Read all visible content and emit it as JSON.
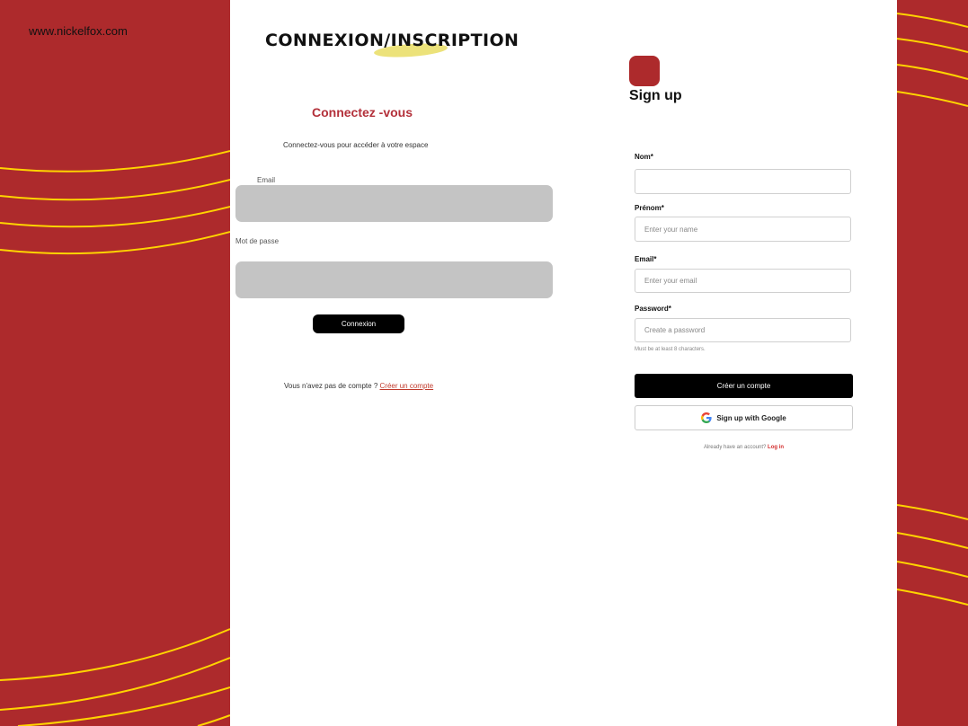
{
  "site": {
    "url": "www.nickelfox.com"
  },
  "colors": {
    "brand_red": "#ad2a2c",
    "accent_yellow": "#ffd400",
    "highlight_yellow": "#ece27a"
  },
  "header": {
    "title_left": "CONNEXION",
    "title_slash": "/",
    "title_right": "INSCRIPTION"
  },
  "login": {
    "heading": "Connectez -vous",
    "subtitle": "Connectez-vous pour accéder à votre espace",
    "email_label": "Email",
    "password_label": "Mot de passe",
    "submit_label": "Connexion",
    "no_account_text": "Vous n'avez pas de compte ?",
    "create_account_link": "Créer un compte"
  },
  "signup": {
    "title": "Sign up",
    "logo_icon": "app-logo-icon",
    "fields": {
      "nom": {
        "label": "Nom*",
        "placeholder": ""
      },
      "prenom": {
        "label": "Prénom*",
        "placeholder": "Enter your name"
      },
      "email": {
        "label": "Email*",
        "placeholder": "Enter your email"
      },
      "password": {
        "label": "Password*",
        "placeholder": "Create a password"
      }
    },
    "password_hint": "Must be at least 8 characters.",
    "create_button": "Créer un compte",
    "google_button": "Sign up with Google",
    "google_icon": "google-icon",
    "already_text": "Already have an account?",
    "login_link": "Log in"
  }
}
